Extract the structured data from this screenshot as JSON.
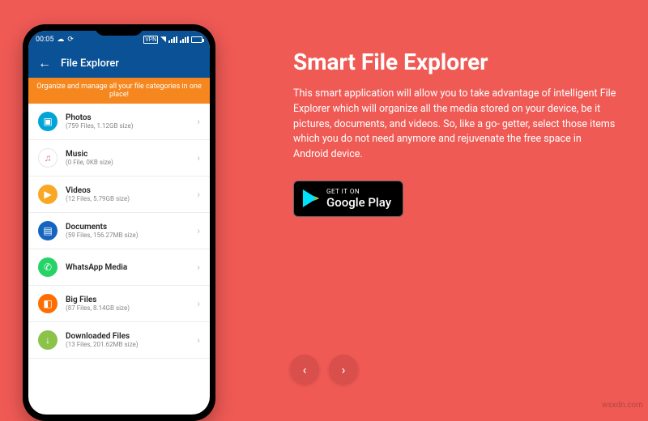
{
  "phone": {
    "status": {
      "time": "00:05"
    },
    "appbar": {
      "title": "File Explorer"
    },
    "banner": "Organize and manage all your file categories in one place!",
    "items": [
      {
        "label": "Photos",
        "sub": "(759 Files, 1.12GB size)",
        "icon": "photos-icon"
      },
      {
        "label": "Music",
        "sub": "(0 File, 0KB size)",
        "icon": "music-icon"
      },
      {
        "label": "Videos",
        "sub": "(12 Files, 5.79GB size)",
        "icon": "videos-icon"
      },
      {
        "label": "Documents",
        "sub": "(59 Files, 156.27MB size)",
        "icon": "documents-icon"
      },
      {
        "label": "WhatsApp Media",
        "sub": "",
        "icon": "whatsapp-icon"
      },
      {
        "label": "Big Files",
        "sub": "(87 Files, 8.14GB size)",
        "icon": "bigfiles-icon"
      },
      {
        "label": "Downloaded Files",
        "sub": "(13 Files, 201.62MB size)",
        "icon": "download-icon"
      }
    ]
  },
  "content": {
    "heading": "Smart File Explorer",
    "body": "This smart application will allow you to take advantage of intelligent File Explorer which will organize all the media stored on your device, be it pictures, documents, and videos. So, like a go- getter, select those items which you do not need anymore and rejuvenate the free space in Android device."
  },
  "badge": {
    "small": "GET IT ON",
    "big": "Google Play"
  },
  "watermark": "wsxdn.com"
}
